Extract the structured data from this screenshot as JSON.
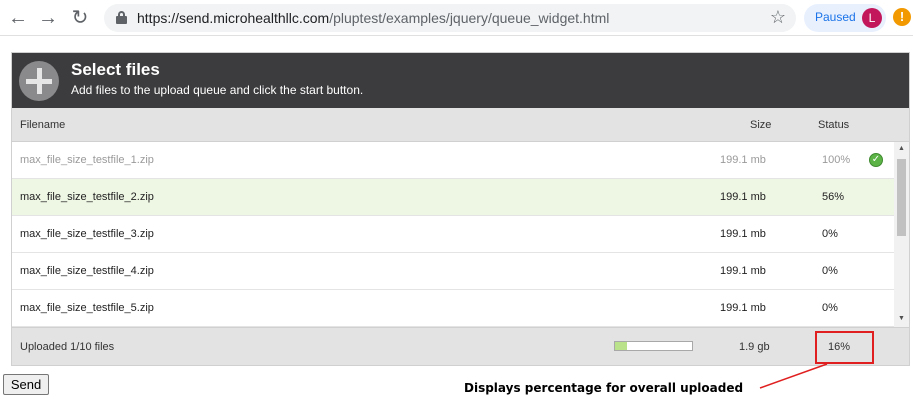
{
  "browser": {
    "url_host": "https://send.microhealthllc.com",
    "url_path": "/pluptest/examples/jquery/queue_widget.html",
    "paused_label": "Paused",
    "avatar_letter": "L",
    "warning_glyph": "!"
  },
  "widget": {
    "title": "Select files",
    "subtitle": "Add files to the upload queue and click the start button.",
    "columns": {
      "filename": "Filename",
      "size": "Size",
      "status": "Status"
    },
    "files": [
      {
        "name": "max_file_size_testfile_1.zip",
        "size": "199.1 mb",
        "status": "100%",
        "state": "done"
      },
      {
        "name": "max_file_size_testfile_2.zip",
        "size": "199.1 mb",
        "status": "56%",
        "state": "uploading"
      },
      {
        "name": "max_file_size_testfile_3.zip",
        "size": "199.1 mb",
        "status": "0%",
        "state": "queued"
      },
      {
        "name": "max_file_size_testfile_4.zip",
        "size": "199.1 mb",
        "status": "0%",
        "state": "queued"
      },
      {
        "name": "max_file_size_testfile_5.zip",
        "size": "199.1 mb",
        "status": "0%",
        "state": "queued"
      }
    ],
    "footer": {
      "uploaded_text": "Uploaded 1/10 files",
      "total_size": "1.9 gb",
      "overall_percent": "16%",
      "overall_progress": 0.16
    }
  },
  "send_button": "Send",
  "annotation": "Displays percentage for overall uploaded",
  "colors": {
    "header_bg": "#3c3c3e",
    "active_row_bg": "#eef6e4",
    "progress_fill": "#b9e28a",
    "highlight": "#e02020",
    "done_check": "#5cb346"
  }
}
